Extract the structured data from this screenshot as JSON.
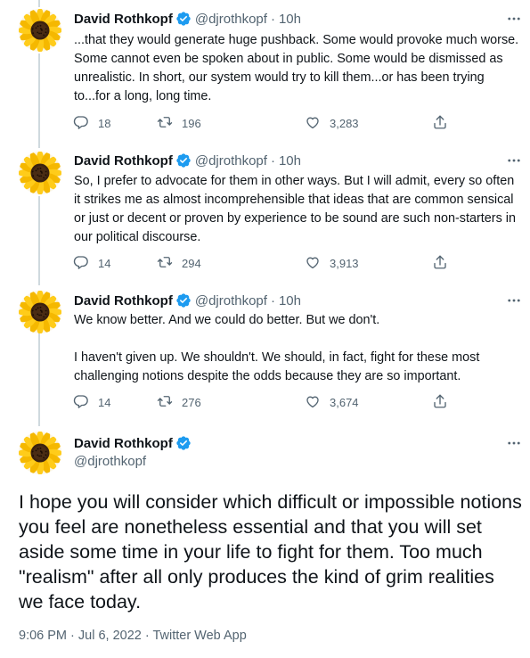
{
  "author": {
    "name": "David Rothkopf",
    "handle": "@djrothkopf"
  },
  "icons": {
    "verified": "verified-badge-icon",
    "more": "more-dots-icon",
    "reply": "reply-icon",
    "retweet": "retweet-icon",
    "like": "heart-icon",
    "share": "share-icon",
    "avatar": "sunflower-avatar"
  },
  "colors": {
    "verified": "#1d9bf0",
    "muted": "#536471",
    "thread_line": "#cfd9de"
  },
  "tweets": [
    {
      "time": "10h",
      "text": "...that they would generate huge pushback. Some would provoke much worse. Some cannot even be spoken about in public. Some would be dismissed as unrealistic. In short, our system would try to kill them...or has been trying to...for a long, long time.",
      "replies": "18",
      "retweets": "196",
      "likes": "3,283"
    },
    {
      "time": "10h",
      "text": "So, I prefer to advocate for them in other ways. But I will admit, every so often it strikes me as almost incomprehensible that ideas that are common sensical or just or decent or proven by experience to be sound are such non-starters in our political discourse.",
      "replies": "14",
      "retweets": "294",
      "likes": "3,913"
    },
    {
      "time": "10h",
      "text": "We know better. And we could do better. But we don't.\n\nI haven't given up. We shouldn't. We should, in fact, fight for these most challenging notions despite the odds because they are so important.",
      "replies": "14",
      "retweets": "276",
      "likes": "3,674"
    }
  ],
  "main_tweet": {
    "text": "I hope you will consider which difficult or impossible notions you feel are nonetheless essential and that you will set aside some time in your life to fight for them. Too much \"realism\" after all only produces the kind of grim realities we face today.",
    "meta": "9:06 PM · Jul 6, 2022 · Twitter Web App"
  }
}
